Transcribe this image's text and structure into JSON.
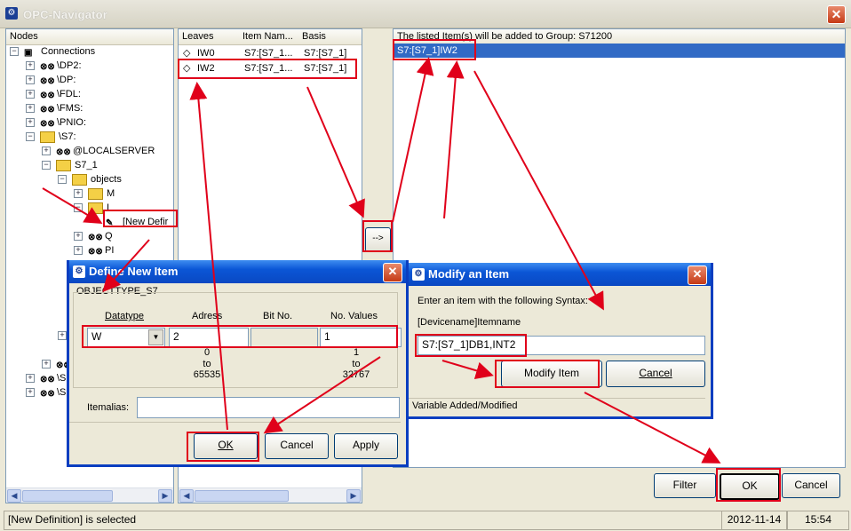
{
  "window": {
    "title": "OPC-Navigator",
    "close_glyph": "✕"
  },
  "nodes": {
    "header": "Nodes",
    "items": [
      {
        "label": "Connections"
      },
      {
        "label": "\\DP2:"
      },
      {
        "label": "\\DP:"
      },
      {
        "label": "\\FDL:"
      },
      {
        "label": "\\FMS:"
      },
      {
        "label": "\\PNIO:"
      },
      {
        "label": "\\S7:"
      },
      {
        "label": "@LOCALSERVER"
      },
      {
        "label": "S7_1"
      },
      {
        "label": "objects"
      },
      {
        "label": "M"
      },
      {
        "label": "I"
      },
      {
        "label": "[New Defir"
      },
      {
        "label": "Q"
      },
      {
        "label": "PI"
      },
      {
        "label": "\\S"
      },
      {
        "label": "\\S"
      }
    ]
  },
  "leaves": {
    "columns": [
      "Leaves",
      "Item Nam...",
      "Basis"
    ],
    "rows": [
      [
        "IW0",
        "S7:[S7_1...",
        "S7:[S7_1]"
      ],
      [
        "IW2",
        "S7:[S7_1...",
        "S7:[S7_1]"
      ]
    ]
  },
  "add_button": "-->",
  "group": {
    "header": "The listed Item(s) will be added to Group: S71200",
    "items": [
      "S7:[S7_1]IW2"
    ]
  },
  "define_dialog": {
    "title": "Define New Item",
    "group_label": "OBJECTTYPE_S7",
    "col_datatype": "Datatype",
    "col_adress": "Adress",
    "col_bitno": "Bit No.",
    "col_novalues": "No. Values",
    "datatype_value": "W",
    "adress_value": "2",
    "bitno_value": "",
    "novalues_value": "1",
    "adress_min": "0",
    "adress_to": "to",
    "adress_max": "65535",
    "novalues_min": "1",
    "novalues_to": "to",
    "novalues_max": "32767",
    "itemalias_label": "Itemalias:",
    "itemalias_value": "",
    "ok": "OK",
    "cancel": "Cancel",
    "apply": "Apply"
  },
  "modify_dialog": {
    "title": "Modify an Item",
    "instruction": "Enter an item with the following Syntax:",
    "syntax": "[Devicename]Itemname",
    "item_value": "S7:[S7_1]DB1,INT2",
    "modify": "Modify Item",
    "cancel": "Cancel",
    "status": "Variable Added/Modified"
  },
  "footer_buttons": {
    "filter": "Filter",
    "ok": "OK",
    "cancel": "Cancel"
  },
  "statusbar": {
    "message": "[New Definition] is selected",
    "date": "2012-11-14",
    "time": "15:54"
  },
  "colors": {
    "accent": "#0a3ec0",
    "annotation": "#e0001a",
    "selection": "#316ac5"
  }
}
